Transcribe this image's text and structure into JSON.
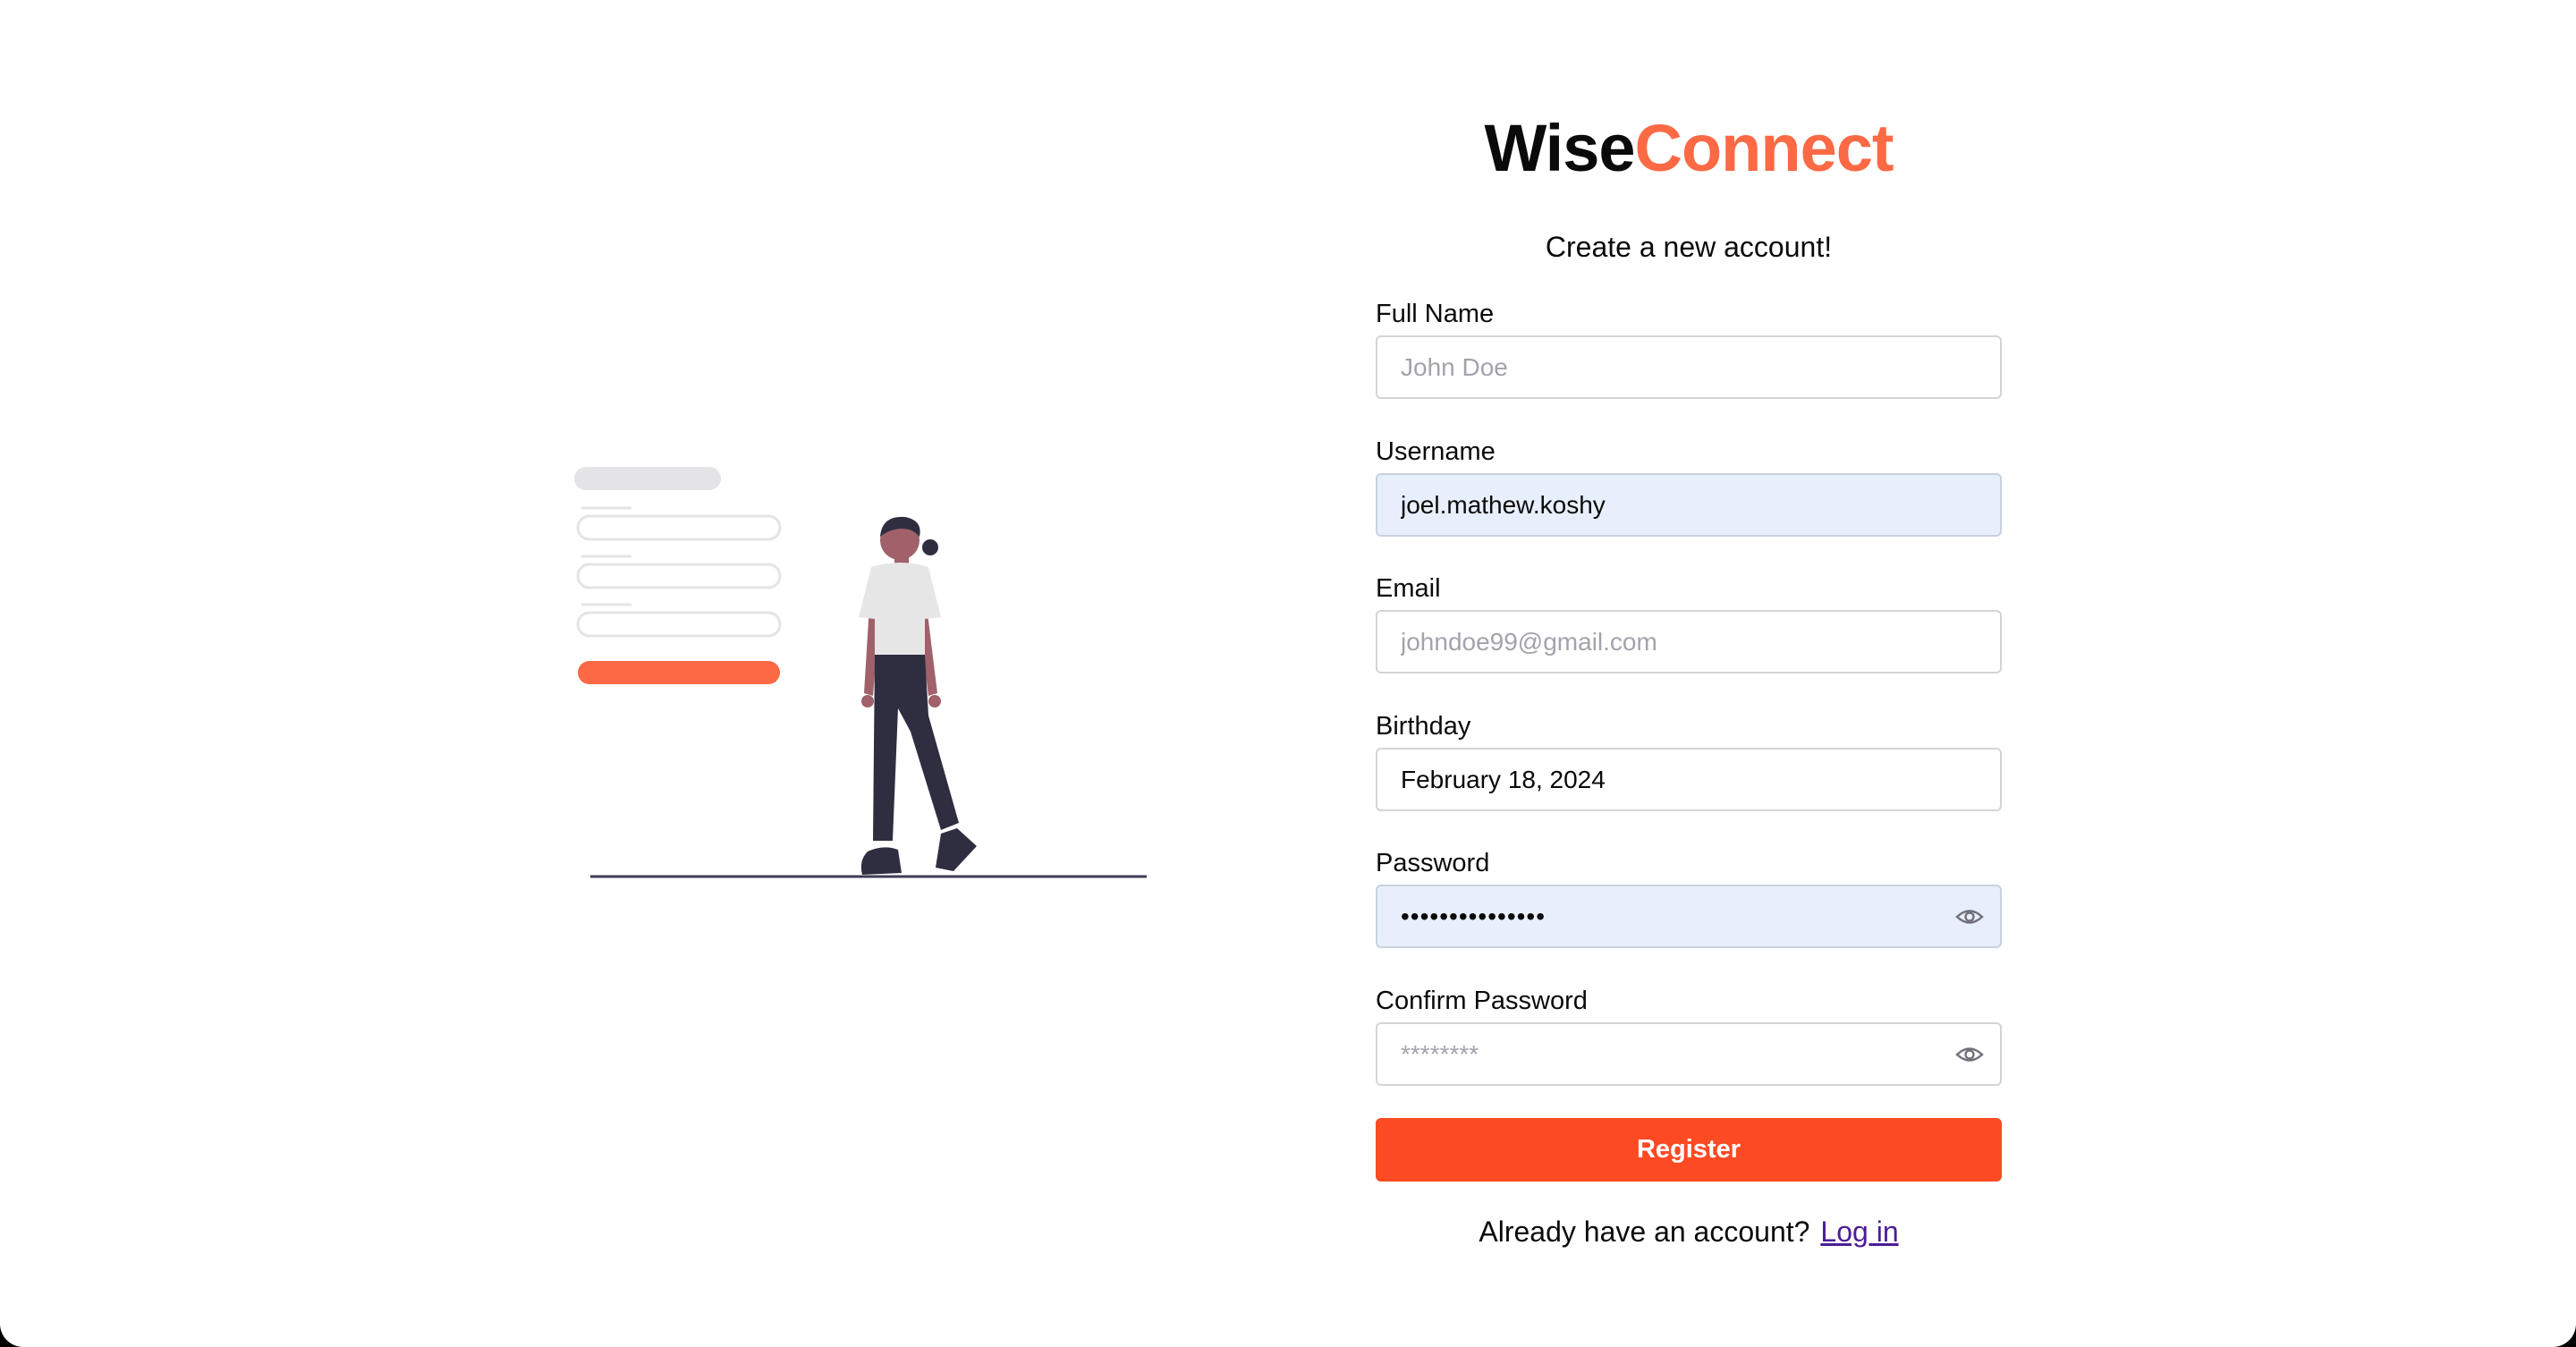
{
  "brand": {
    "part1": "Wise",
    "part2": "Connect",
    "accent_color": "#fb6a44"
  },
  "subtitle": "Create a new account!",
  "fields": {
    "full_name": {
      "label": "Full Name",
      "value": "",
      "placeholder": "John Doe"
    },
    "username": {
      "label": "Username",
      "value": "joel.mathew.koshy",
      "placeholder": ""
    },
    "email": {
      "label": "Email",
      "value": "",
      "placeholder": "johndoe99@gmail.com"
    },
    "birthday": {
      "label": "Birthday",
      "value": "February 18, 2024"
    },
    "password": {
      "label": "Password",
      "value": "•••••••••••••••",
      "icon": "eye-icon"
    },
    "confirm_password": {
      "label": "Confirm Password",
      "value": "",
      "placeholder": "********",
      "icon": "eye-icon"
    }
  },
  "register_button": {
    "label": "Register",
    "color": "#fc4a23"
  },
  "login_prompt": {
    "text": "Already have an account?",
    "link": "Log in"
  }
}
